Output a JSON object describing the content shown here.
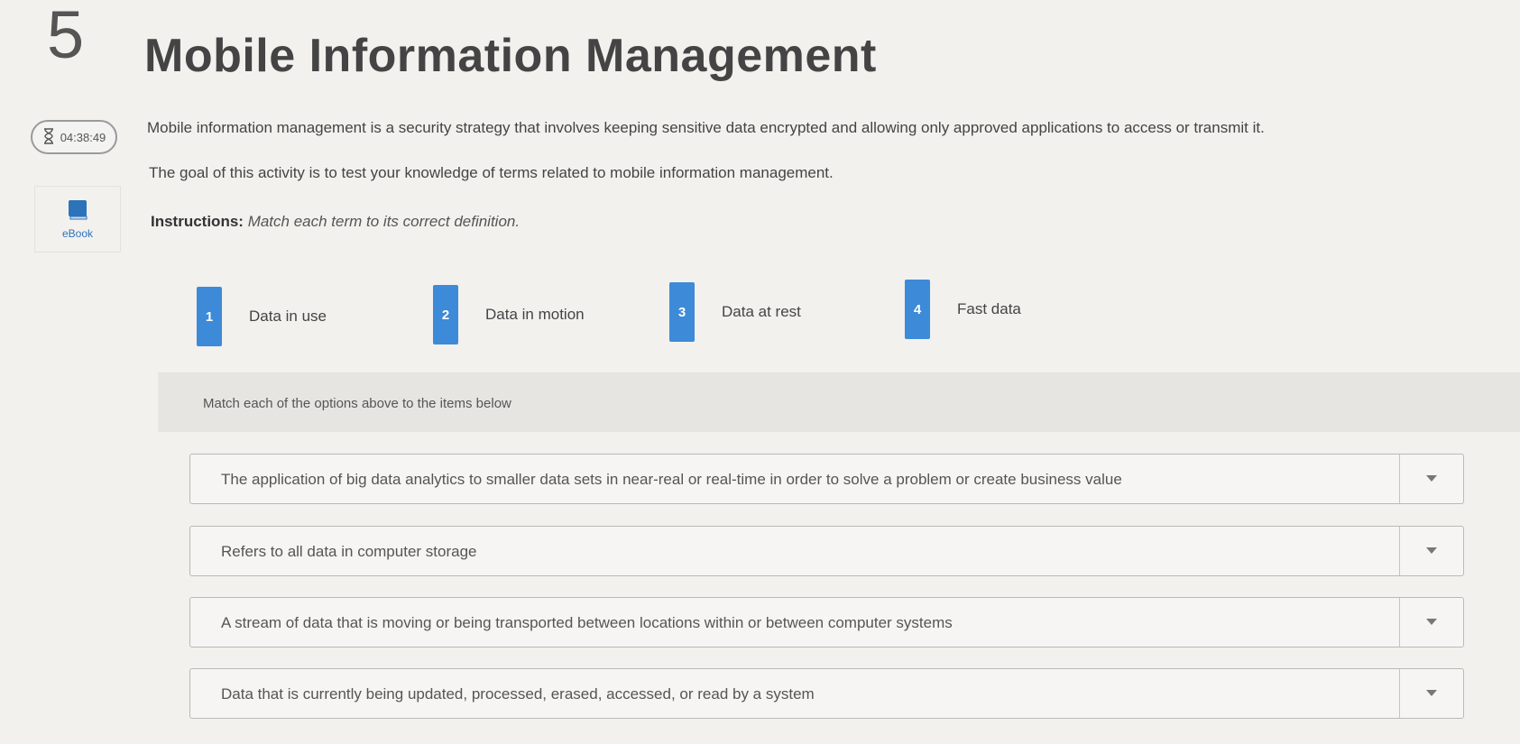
{
  "question_number": "5",
  "title": "Mobile Information Management",
  "timer": {
    "value": "04:38:49",
    "icon": "hourglass-icon"
  },
  "ebook": {
    "label": "eBook",
    "icon": "book-icon"
  },
  "description": "Mobile information management is a security strategy that involves keeping sensitive data encrypted and allowing only approved applications to access or transmit it.",
  "goal": "The goal of this activity is to test your knowledge of terms related to mobile information management.",
  "instructions": {
    "label": "Instructions:",
    "text": "Match each term to its correct definition."
  },
  "terms": [
    {
      "num": "1",
      "label": "Data in use"
    },
    {
      "num": "2",
      "label": "Data in motion"
    },
    {
      "num": "3",
      "label": "Data at rest"
    },
    {
      "num": "4",
      "label": "Fast data"
    }
  ],
  "match_prompt": "Match each of the options above to the items below",
  "items": [
    {
      "text": "The application of big data analytics to smaller data sets in near-real or real-time in order to solve a problem or create business value"
    },
    {
      "text": "Refers to all data in computer storage"
    },
    {
      "text": "A stream of data that is moving or being transported between locations within or between computer systems"
    },
    {
      "text": "Data that is currently being updated, processed, erased, accessed, or read by a system"
    }
  ],
  "colors": {
    "badge": "#3d8ad8",
    "ebook": "#2d73b9"
  }
}
